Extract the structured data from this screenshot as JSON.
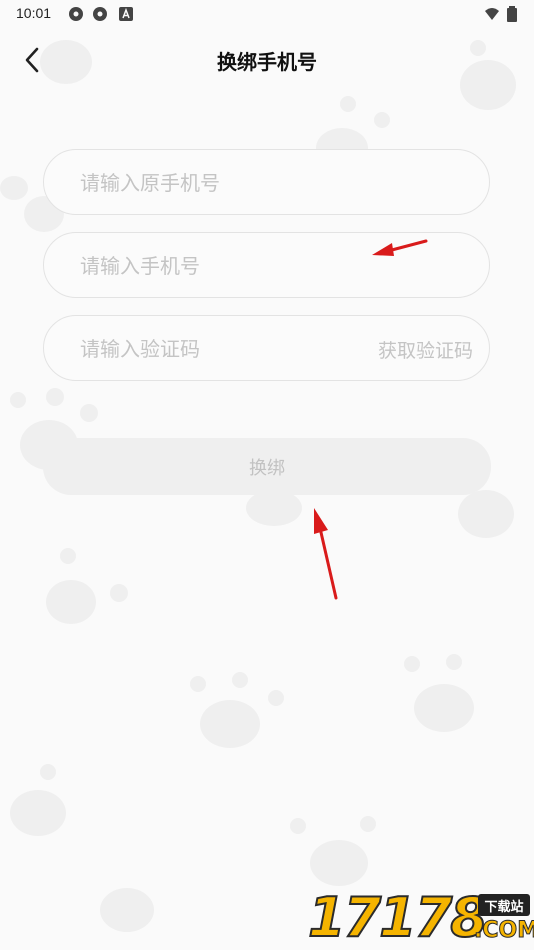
{
  "status_bar": {
    "time": "10:01",
    "icons": [
      "gear-icon",
      "gear-icon",
      "app-a-icon"
    ],
    "right_icons": [
      "wifi-icon",
      "battery-icon"
    ]
  },
  "header": {
    "title": "换绑手机号",
    "back_icon": "chevron-left-icon"
  },
  "form": {
    "old_phone_placeholder": "请输入原手机号",
    "new_phone_placeholder": "请输入手机号",
    "code_placeholder": "请输入验证码",
    "get_code_label": "获取验证码",
    "submit_label": "换绑"
  },
  "annotations": {
    "arrow_color": "#d91b1b"
  },
  "watermark": {
    "digits": "17178",
    "badge": "下载站",
    "domain": ".COM"
  },
  "colors": {
    "background": "#fafafa",
    "field_border": "#e3e3e3",
    "placeholder": "#c4c4c4",
    "button_bg": "#efefef"
  }
}
